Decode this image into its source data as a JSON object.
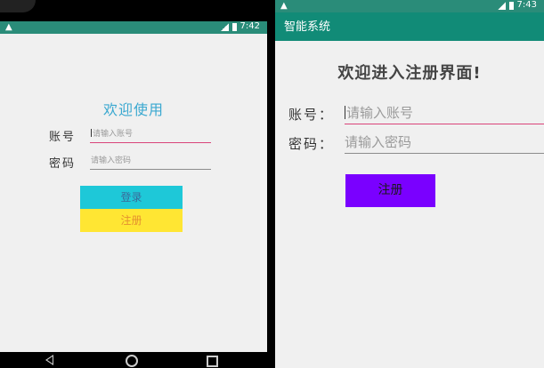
{
  "left_phone": {
    "status": {
      "time": "7:42",
      "warning_icon": "warning-icon"
    },
    "welcome": "欢迎使用",
    "account_label": "账号",
    "account_placeholder": "请输入账号",
    "password_label": "密码",
    "password_placeholder": "请输入密码",
    "login_label": "登录",
    "register_label": "注册",
    "nav": {
      "back": "back-icon",
      "home": "home-icon",
      "recent": "recent-apps-icon"
    }
  },
  "right_phone": {
    "status": {
      "time": "7:43",
      "warning_icon": "warning-icon"
    },
    "app_title": "智能系统",
    "welcome": "欢迎进入注册界面!",
    "account_label": "账号：",
    "account_placeholder": "请输入账号",
    "password_label": "密码：",
    "password_placeholder": "请输入密码",
    "register_label": "注册"
  },
  "colors": {
    "status_bar": "#2a8c79",
    "app_bar": "#118b77",
    "welcome_left": "#3aa8d0",
    "login_button": "#1ec8d8",
    "register_button_left": "#ffe633",
    "register_button_right": "#7a00ff",
    "active_underline": "#d9447a"
  }
}
